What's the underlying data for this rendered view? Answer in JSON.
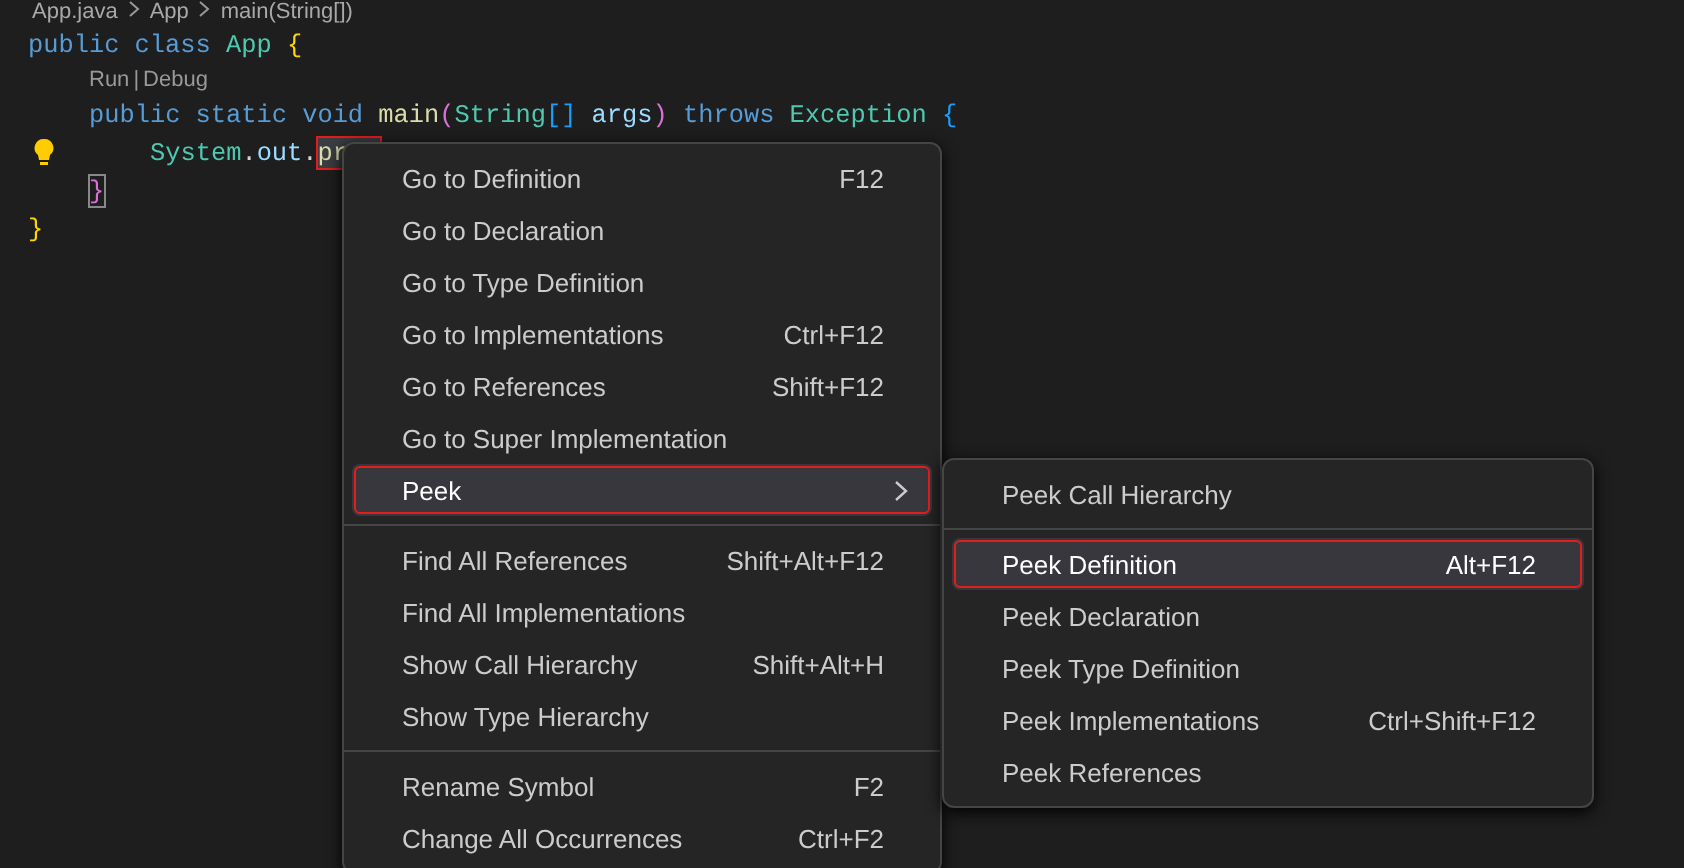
{
  "breadcrumb": [
    "App.java",
    "App",
    "main(String[])"
  ],
  "code": [
    {
      "kind": "code",
      "lightbulb": false,
      "tokens": [
        {
          "text": "public ",
          "kind": "keyword"
        },
        {
          "text": "class ",
          "kind": "keyword"
        },
        {
          "text": "App ",
          "kind": "class"
        },
        {
          "text": "{",
          "kind": "brace"
        }
      ],
      "children": [
        {
          "kind": "codelens",
          "links": [
            "Run",
            "Debug"
          ],
          "separator": "|"
        },
        {
          "kind": "code",
          "lightbulb": false,
          "tokens": [
            {
              "text": "public ",
              "kind": "keyword"
            },
            {
              "text": "static ",
              "kind": "keyword"
            },
            {
              "text": "void ",
              "kind": "keyword"
            },
            {
              "text": "main",
              "kind": "function"
            },
            {
              "text": "(",
              "kind": "paren"
            },
            {
              "text": "String",
              "kind": "class"
            },
            {
              "text": "[] ",
              "kind": "bracket"
            },
            {
              "text": "args",
              "kind": "variable"
            },
            {
              "text": ") ",
              "kind": "paren"
            },
            {
              "text": "throws ",
              "kind": "keyword"
            },
            {
              "text": "Exception ",
              "kind": "class"
            },
            {
              "text": "{",
              "kind": "bracket"
            }
          ],
          "children": [
            {
              "kind": "code",
              "lightbulb": true,
              "tokens": [
                {
                  "text": "System",
                  "kind": "class"
                },
                {
                  "text": ".",
                  "kind": "plain"
                },
                {
                  "text": "out",
                  "kind": "variable"
                },
                {
                  "text": ".",
                  "kind": "plain"
                },
                {
                  "text": "pr",
                  "kind": "function",
                  "marked": true
                }
              ]
            }
          ]
        },
        {
          "kind": "code",
          "lightbulb": false,
          "tokens": [
            {
              "text": "}",
              "kind": "paren",
              "matched": true
            }
          ]
        }
      ]
    },
    {
      "kind": "code",
      "lightbulb": false,
      "tokens": [
        {
          "text": "}",
          "kind": "brace"
        }
      ]
    }
  ],
  "context_menu": {
    "groups": [
      [
        {
          "label": "Go to Definition",
          "shortcut": "F12",
          "selected": false,
          "submenu": false
        },
        {
          "label": "Go to Declaration",
          "selected": false,
          "submenu": false
        },
        {
          "label": "Go to Type Definition",
          "selected": false,
          "submenu": false
        },
        {
          "label": "Go to Implementations",
          "shortcut": "Ctrl+F12",
          "selected": false,
          "submenu": false
        },
        {
          "label": "Go to References",
          "shortcut": "Shift+F12",
          "selected": false,
          "submenu": false
        },
        {
          "label": "Go to Super Implementation",
          "selected": false,
          "submenu": false
        },
        {
          "label": "Peek",
          "selected": true,
          "submenu": true
        }
      ],
      [
        {
          "label": "Find All References",
          "shortcut": "Shift+Alt+F12",
          "selected": false,
          "submenu": false
        },
        {
          "label": "Find All Implementations",
          "selected": false,
          "submenu": false
        },
        {
          "label": "Show Call Hierarchy",
          "shortcut": "Shift+Alt+H",
          "selected": false,
          "submenu": false
        },
        {
          "label": "Show Type Hierarchy",
          "selected": false,
          "submenu": false
        }
      ],
      [
        {
          "label": "Rename Symbol",
          "shortcut": "F2",
          "selected": false,
          "submenu": false
        },
        {
          "label": "Change All Occurrences",
          "shortcut": "Ctrl+F2",
          "selected": false,
          "submenu": false
        }
      ]
    ]
  },
  "peek_submenu": {
    "groups": [
      [
        {
          "label": "Peek Call Hierarchy",
          "selected": false
        }
      ],
      [
        {
          "label": "Peek Definition",
          "shortcut": "Alt+F12",
          "selected": true
        },
        {
          "label": "Peek Declaration",
          "selected": false
        },
        {
          "label": "Peek Type Definition",
          "selected": false
        },
        {
          "label": "Peek Implementations",
          "shortcut": "Ctrl+Shift+F12",
          "selected": false
        },
        {
          "label": "Peek References",
          "selected": false
        }
      ]
    ]
  }
}
